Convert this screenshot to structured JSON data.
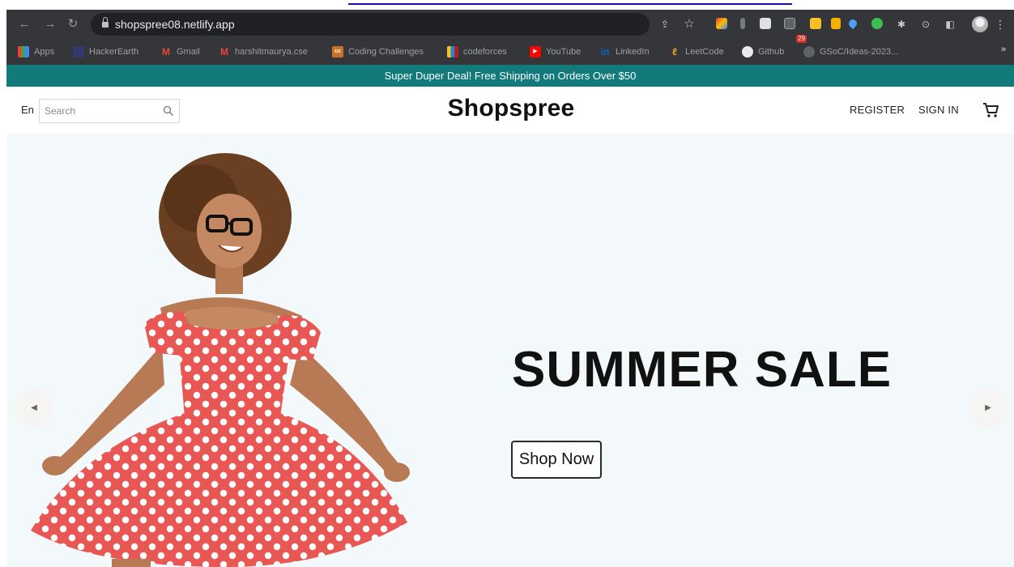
{
  "browser": {
    "url": "shopspree08.netlify.app",
    "notification_badge": "29",
    "bookmarks": [
      {
        "label": "Apps",
        "icon": "apps-grid-icon"
      },
      {
        "label": "HackerEarth",
        "icon": "hackerearth-icon"
      },
      {
        "label": "Gmail",
        "icon": "gmail-icon"
      },
      {
        "label": "harshitmaurya.cse",
        "icon": "gmail-icon"
      },
      {
        "label": "Coding Challenges",
        "icon": "coding-challenges-icon"
      },
      {
        "label": "codeforces",
        "icon": "codeforces-icon"
      },
      {
        "label": "YouTube",
        "icon": "youtube-icon"
      },
      {
        "label": "LinkedIn",
        "icon": "linkedin-icon"
      },
      {
        "label": "LeetCode",
        "icon": "leetcode-icon"
      },
      {
        "label": "Github",
        "icon": "github-icon"
      },
      {
        "label": "GSoC/Ideas-2023...",
        "icon": "github-icon"
      }
    ],
    "more_bookmarks": "»"
  },
  "promo": {
    "text": "Super Duper Deal! Free Shipping on Orders Over $50",
    "background": "#127a7a"
  },
  "header": {
    "language": "En",
    "search_placeholder": "Search",
    "logo": "Shopspree",
    "register": "REGISTER",
    "sign_in": "SIGN IN"
  },
  "hero": {
    "title": "SUMMER SALE",
    "button_label": "Shop Now",
    "prev_arrow": "◀",
    "next_arrow": "▶",
    "background": "#f3f8fa"
  }
}
